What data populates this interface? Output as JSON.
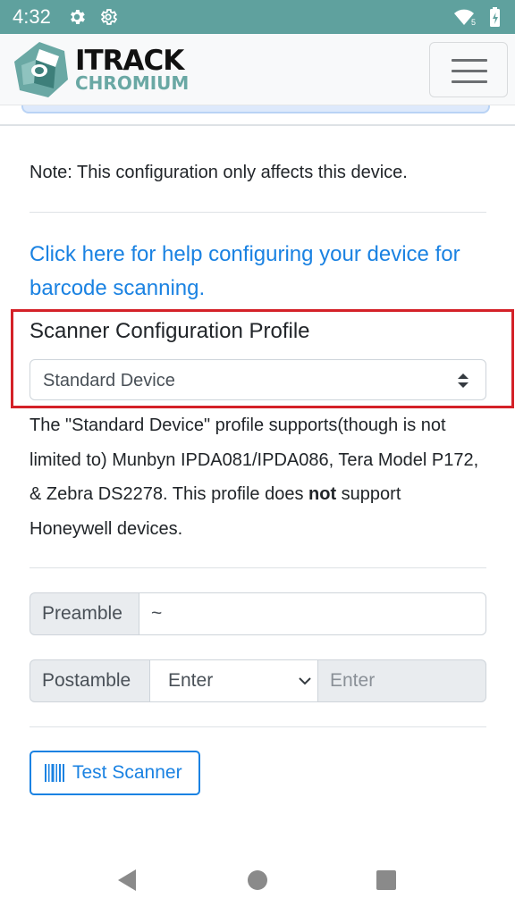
{
  "status_bar": {
    "time": "4:32",
    "background": "#5fa19e",
    "icons": [
      "settings-gear-icon",
      "settings-gear-outline-icon",
      "wifi-icon",
      "battery-charging-icon"
    ],
    "wifi_badge": "5"
  },
  "navbar": {
    "brand_line1": "ITRACK",
    "brand_line2": "CHROMIUM",
    "brand_accent": "#6aa8a4",
    "menu_icon": "hamburger-menu-icon"
  },
  "main": {
    "note": "Note: This configuration only affects this device.",
    "help_link": "Click here for help configuring your device for barcode scanning.",
    "link_color": "#1a82e2",
    "highlight_color": "#d42128",
    "profile": {
      "label": "Scanner Configuration Profile",
      "selected": "Standard Device"
    },
    "description": {
      "part1": "The \"Standard Device\" profile supports(though is not limited to) Munbyn IPDA081/IPDA086, Tera Model P172, & Zebra DS2278. This profile does ",
      "bold": "not",
      "part2": " support Honeywell devices."
    },
    "preamble": {
      "label": "Preamble",
      "value": "~"
    },
    "postamble": {
      "label": "Postamble",
      "selected": "Enter",
      "placeholder": "Enter"
    },
    "test_button": {
      "label": "Test Scanner",
      "icon": "barcode-icon"
    }
  },
  "android_nav": {
    "icons": [
      "back-icon",
      "home-icon",
      "recents-icon"
    ]
  }
}
